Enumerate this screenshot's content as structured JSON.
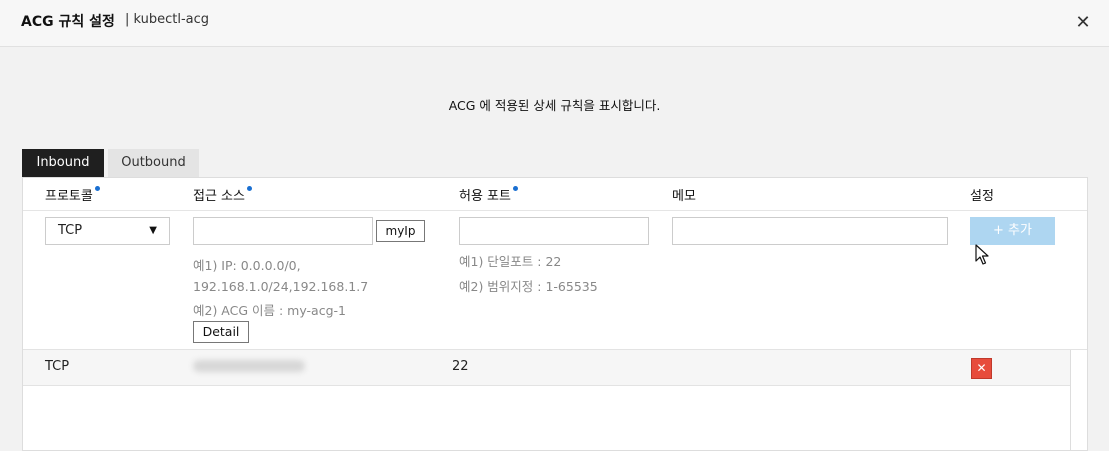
{
  "dialog": {
    "title": "ACG 규칙 설정",
    "subtitle": "| kubectl-acg",
    "close_symbol": "✕"
  },
  "description": "ACG 에 적용된 상세 규칙을 표시합니다.",
  "tabs": [
    {
      "label": "Inbound",
      "active": true
    },
    {
      "label": "Outbound",
      "active": false
    }
  ],
  "columns": {
    "protocol": "프로토콜",
    "source": "접근 소스",
    "port": "허용 포트",
    "memo": "메모",
    "settings": "설정"
  },
  "form": {
    "protocol_value": "TCP",
    "source_value": "",
    "myip_label": "myIp",
    "port_value": "",
    "memo_value": "",
    "add_label": "+ 추가",
    "source_hints": {
      "ex1_line1": "예1) IP: 0.0.0.0/0,",
      "ex1_line2": "192.168.1.0/24,192.168.1.7",
      "ex2": "예2) ACG 이름 : my-acg-1"
    },
    "detail_label": "Detail",
    "port_hints": {
      "ex1": "예1) 단일포트 : 22",
      "ex2": "예2) 범위지정 : 1-65535"
    }
  },
  "rules": [
    {
      "protocol": "TCP",
      "source": "",
      "port": "22",
      "delete_symbol": "✕"
    }
  ],
  "colors": {
    "accent_dot": "#1a6fd1",
    "add_button": "#aed6f1",
    "delete_button": "#e74c3c",
    "active_tab": "#1f1f1f"
  }
}
